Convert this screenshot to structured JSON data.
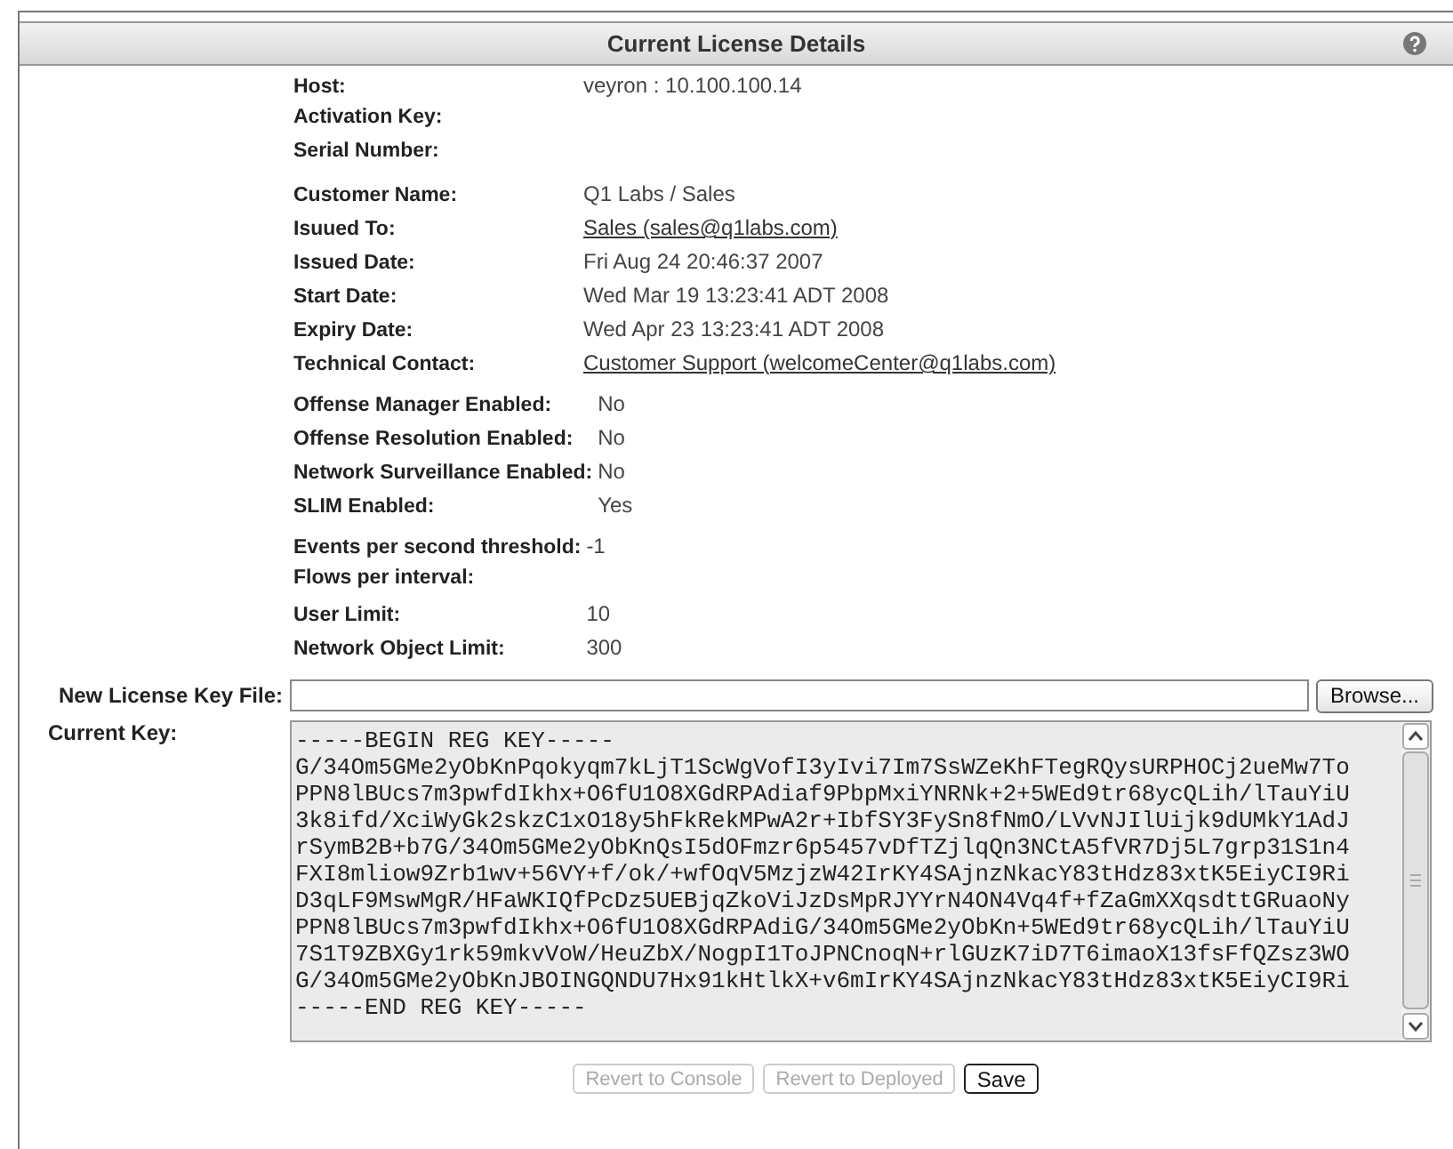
{
  "panel": {
    "title": "Current License Details"
  },
  "detail_groups": [
    {
      "rows": [
        {
          "label": "Host:",
          "value": "veyron : 10.100.100.14",
          "link": false
        },
        {
          "label": "Activation Key:"
        },
        {
          "label": "Serial Number:"
        }
      ]
    },
    {
      "rows": [
        {
          "label": "Customer Name:",
          "value": "Q1 Labs / Sales",
          "link": false
        },
        {
          "label": "Isuued To:",
          "value": "Sales (sales@q1labs.com)",
          "link": true
        },
        {
          "label": "Issued Date:",
          "value": "Fri Aug 24 20:46:37 2007",
          "link": false
        },
        {
          "label": "Start Date:",
          "value": "Wed Mar 19 13:23:41 ADT 2008",
          "link": false
        },
        {
          "label": "Expiry Date:",
          "value": "Wed Apr 23 13:23:41 ADT 2008",
          "link": false
        },
        {
          "label": "Technical Contact:",
          "value": "Customer Support (welcomeCenter@q1labs.com)",
          "link": true
        }
      ]
    },
    {
      "rows": [
        {
          "label": "Offense Manager Enabled:",
          "value": "No",
          "link": false
        },
        {
          "label": "Offense Resolution Enabled:",
          "value": "No",
          "link": false
        },
        {
          "label": "Network Surveillance Enabled:",
          "value": "No",
          "link": false
        },
        {
          "label": "SLIM Enabled:",
          "value": "Yes",
          "link": false
        }
      ]
    },
    {
      "rows": [
        {
          "label": "Events per second threshold:",
          "value": "-1",
          "link": false
        },
        {
          "label": "Flows per interval:"
        },
        {
          "label": "User Limit:",
          "value": "10",
          "link": false
        },
        {
          "label": "Network Object Limit:",
          "value": "300",
          "link": false
        }
      ]
    }
  ],
  "new_key_file": {
    "label": "New License Key File:",
    "browse": "Browse..."
  },
  "current_key": {
    "label": "Current Key:",
    "lines": [
      "-----BEGIN REG KEY-----",
      "G/34Om5GMe2yObKnPqokyqm7kLjT1ScWgVofI3yIvi7Im7SsWZeKhFTegRQysURPHOCj2ueMw7To",
      "PPN8lBUcs7m3pwfdIkhx+O6fU1O8XGdRPAdiaf9PbpMxiYNRNk+2+5WEd9tr68ycQLih/lTauYiU",
      "3k8ifd/XciWyGk2skzC1xO18y5hFkRekMPwA2r+IbfSY3FySn8fNmO/LVvNJIlUijk9dUMkY1AdJ",
      "rSymB2B+b7G/34Om5GMe2yObKnQsI5dOFmzr6p5457vDfTZjlqQn3NCtA5fVR7Dj5L7grp31S1n4",
      "FXI8mliow9Zrb1wv+56VY+f/ok/+wfOqV5MzjzW42IrKY4SAjnzNkacY83tHdz83xtK5EiyCI9Ri",
      "D3qLF9MswMgR/HFaWKIQfPcDz5UEBjqZkoViJzDsMpRJYYrN4ON4Vq4f+fZaGmXXqsdttGRuaoNy",
      "PPN8lBUcs7m3pwfdIkhx+O6fU1O8XGdRPAdiG/34Om5GMe2yObKn+5WEd9tr68ycQLih/lTauYiU",
      "7S1T9ZBXGy1rk59mkvVoW/HeuZbX/NogpI1ToJPNCnoqN+rlGUzK7iD7T6imaoX13fsFfQZsz3WO",
      "G/34Om5GMe2yObKnJBOINGQNDU7Hx91kHtlkX+v6mIrKY4SAjnzNkacY83tHdz83xtK5EiyCI9Ri",
      "-----END REG KEY-----"
    ]
  },
  "buttons": [
    {
      "label": "Revert to Console",
      "disabled": true
    },
    {
      "label": "Revert to Deployed",
      "disabled": true
    },
    {
      "label": "Save",
      "disabled": false
    }
  ]
}
